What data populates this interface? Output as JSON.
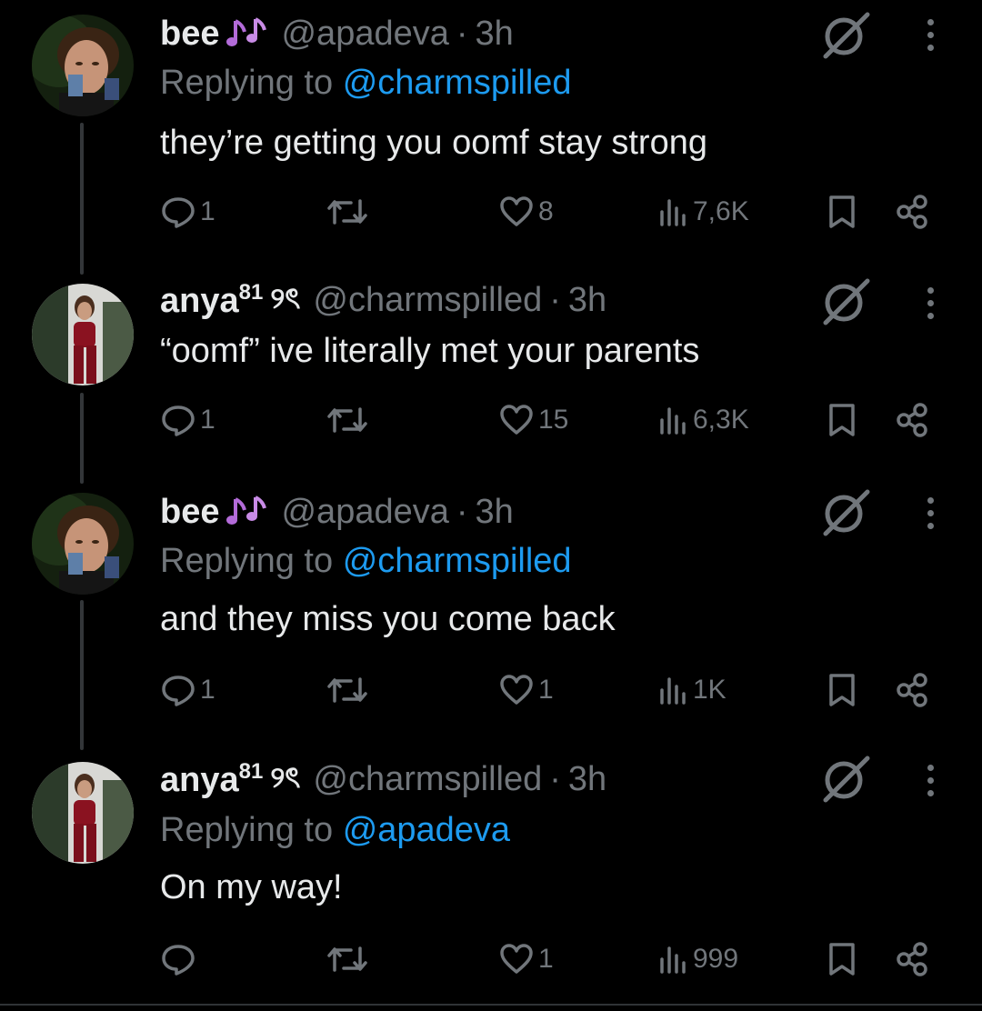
{
  "tweets": [
    {
      "name": "bee",
      "handle": "@apadeva",
      "separator": "·",
      "time": "3h",
      "replying_prefix": "Replying to",
      "replying_to": "@charmspilled",
      "text": "they’re getting you oomf stay strong",
      "replies": "1",
      "likes": "8",
      "views": "7,6K",
      "name_decoration": "purple-music-notes"
    },
    {
      "name": "anya",
      "name_sup": "81",
      "name_decoration_text": "୨ৎ",
      "handle": "@charmspilled",
      "separator": "·",
      "time": "3h",
      "text": "“oomf” ive literally met your parents",
      "replies": "1",
      "likes": "15",
      "views": "6,3K"
    },
    {
      "name": "bee",
      "handle": "@apadeva",
      "separator": "·",
      "time": "3h",
      "replying_prefix": "Replying to",
      "replying_to": "@charmspilled",
      "text": "and they miss you come back",
      "replies": "1",
      "likes": "1",
      "views": "1K",
      "name_decoration": "purple-music-notes"
    },
    {
      "name": "anya",
      "name_sup": "81",
      "name_decoration_text": "୨ৎ",
      "handle": "@charmspilled",
      "separator": "·",
      "time": "3h",
      "replying_prefix": "Replying to",
      "replying_to": "@apadeva",
      "text": "On my way!",
      "replies": "",
      "likes": "1",
      "views": "999"
    }
  ],
  "colors": {
    "background": "#000000",
    "text": "#e7e9ea",
    "muted": "#71767b",
    "link": "#1d9bf0",
    "thread_line": "#333639",
    "notes": "#b36bd9"
  }
}
